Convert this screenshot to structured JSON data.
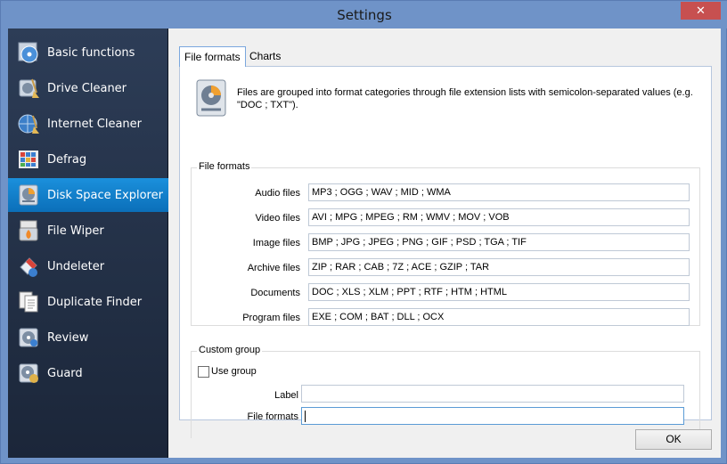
{
  "window": {
    "title": "Settings",
    "close_glyph": "✕"
  },
  "sidebar": {
    "items": [
      {
        "label": "Basic functions",
        "icon": "disc-icon"
      },
      {
        "label": "Drive Cleaner",
        "icon": "broom-drive-icon"
      },
      {
        "label": "Internet Cleaner",
        "icon": "globe-broom-icon"
      },
      {
        "label": "Defrag",
        "icon": "defrag-blocks-icon"
      },
      {
        "label": "Disk Space Explorer",
        "icon": "disk-chart-icon",
        "active": true
      },
      {
        "label": "File Wiper",
        "icon": "shredder-icon"
      },
      {
        "label": "Undeleter",
        "icon": "eraser-icon"
      },
      {
        "label": "Duplicate Finder",
        "icon": "duplicate-docs-icon"
      },
      {
        "label": "Review",
        "icon": "review-disc-icon"
      },
      {
        "label": "Guard",
        "icon": "guard-disc-icon"
      }
    ]
  },
  "tabs": [
    {
      "label": "File formats",
      "active": true
    },
    {
      "label": "Charts",
      "active": false
    }
  ],
  "info": {
    "text": "Files are grouped into format categories through file extension lists with semicolon-separated values (e.g. \"DOC ; TXT\")."
  },
  "file_formats": {
    "title": "File formats",
    "rows": [
      {
        "label": "Audio files",
        "value": "MP3 ; OGG ; WAV ; MID ; WMA"
      },
      {
        "label": "Video files",
        "value": "AVI ; MPG ; MPEG ; RM ; WMV ; MOV ; VOB"
      },
      {
        "label": "Image files",
        "value": "BMP ; JPG ; JPEG ; PNG ; GIF ; PSD ; TGA ; TIF"
      },
      {
        "label": "Archive files",
        "value": "ZIP ; RAR ; CAB ; 7Z ; ACE ; GZIP ; TAR"
      },
      {
        "label": "Documents",
        "value": "DOC ; XLS ; XLM ; PPT ; RTF ; HTM ; HTML"
      },
      {
        "label": "Program files",
        "value": "EXE ; COM ; BAT ; DLL ; OCX"
      }
    ]
  },
  "custom_group": {
    "title": "Custom group",
    "use_group_label": "Use group",
    "use_group_checked": false,
    "label_field_label": "Label",
    "label_value": "",
    "formats_field_label": "File formats",
    "formats_value": ""
  },
  "buttons": {
    "ok": "OK"
  },
  "colors": {
    "active_nav": "#1b90dc",
    "sidebar_bg": "#2d3d57",
    "frame": "#6f93c8"
  }
}
